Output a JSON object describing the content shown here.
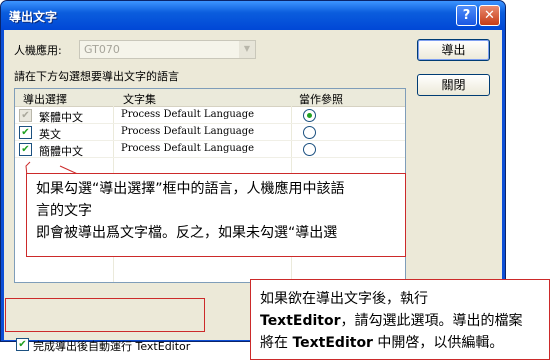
{
  "window": {
    "title": "導出文字",
    "help": "?",
    "close": "✕"
  },
  "form": {
    "hmi_label": "人機應用:",
    "hmi_value": "GT070",
    "instruction": "請在下方勾選想要導出文字的語言"
  },
  "buttons": {
    "export": "導出",
    "close": "關閉"
  },
  "table": {
    "headers": [
      "導出選擇",
      "文字集",
      "當作參照"
    ],
    "rows": [
      {
        "checked": true,
        "disabled": true,
        "language": "繁體中文",
        "charset": "Process Default Language",
        "reference": true
      },
      {
        "checked": true,
        "disabled": false,
        "language": "英文",
        "charset": "Process Default Language",
        "reference": false
      },
      {
        "checked": true,
        "disabled": false,
        "language": "簡體中文",
        "charset": "Process Default Language",
        "reference": false
      }
    ]
  },
  "callout1": {
    "line1": "如果勾選“導出選擇”框中的語言，人機應用中該語",
    "line2": "言的文字",
    "line3": "即會被導出爲文字檔。反之，如果未勾選“導出選"
  },
  "callout2": {
    "line1": "如果欲在導出文字後，執行",
    "line2_bold": "TextEditor",
    "line2_rest": "，請勾選此選項。導出的檔案",
    "line3_pre": "將在 ",
    "line3_bold": "TextEditor",
    "line3_rest": " 中開啓，以供編輯。"
  },
  "auto_run": {
    "checked": true,
    "label": "完成導出後自動運行 TextEditor"
  }
}
